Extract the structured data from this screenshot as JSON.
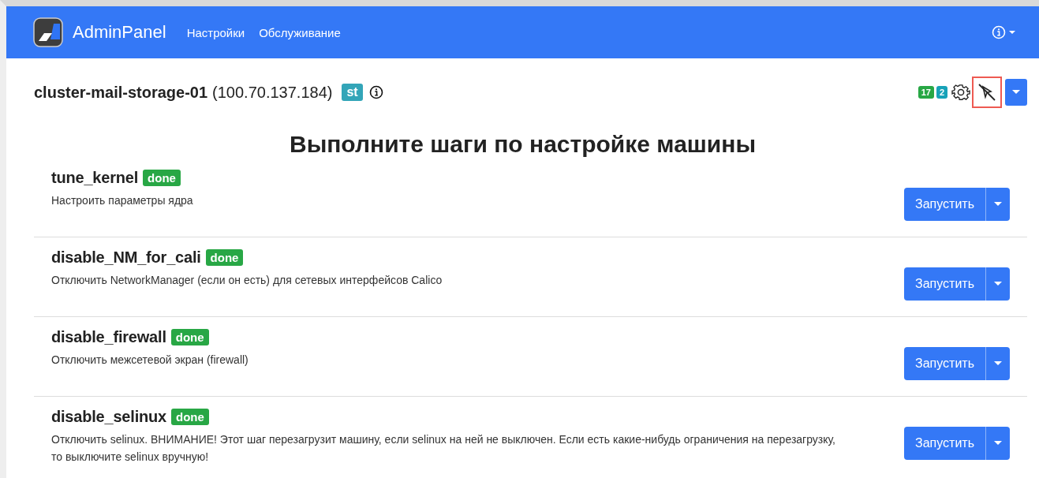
{
  "navbar": {
    "brand": "AdminPanel",
    "links": [
      "Настройки",
      "Обслуживание"
    ]
  },
  "host": {
    "name": "cluster-mail-storage-01",
    "address": "(100.70.137.184)",
    "tag": "st"
  },
  "counters": [
    {
      "text": "17",
      "color": "#28a745"
    },
    {
      "text": "2",
      "color": "#17a2b8"
    }
  ],
  "toolbar": {
    "highlighted_icon": true
  },
  "heading": "Выполните шаги по настройке машины",
  "steps": [
    {
      "name": "tune_kernel",
      "status": "done",
      "description": "Настроить параметры ядра",
      "button": "Запустить"
    },
    {
      "name": "disable_NM_for_cali",
      "status": "done",
      "description": "Отключить NetworkManager (если он есть) для сетевых интерфейсов Calico",
      "button": "Запустить"
    },
    {
      "name": "disable_firewall",
      "status": "done",
      "description": "Отключить межсетевой экран (firewall)",
      "button": "Запустить"
    },
    {
      "name": "disable_selinux",
      "status": "done",
      "description": "Отключить selinux. ВНИМАНИЕ! Этот шаг перезагрузит машину, если selinux на ней не выключен. Если есть какие-нибудь ограничения на перезагрузку, то выключите selinux вручную!",
      "button": "Запустить"
    }
  ]
}
